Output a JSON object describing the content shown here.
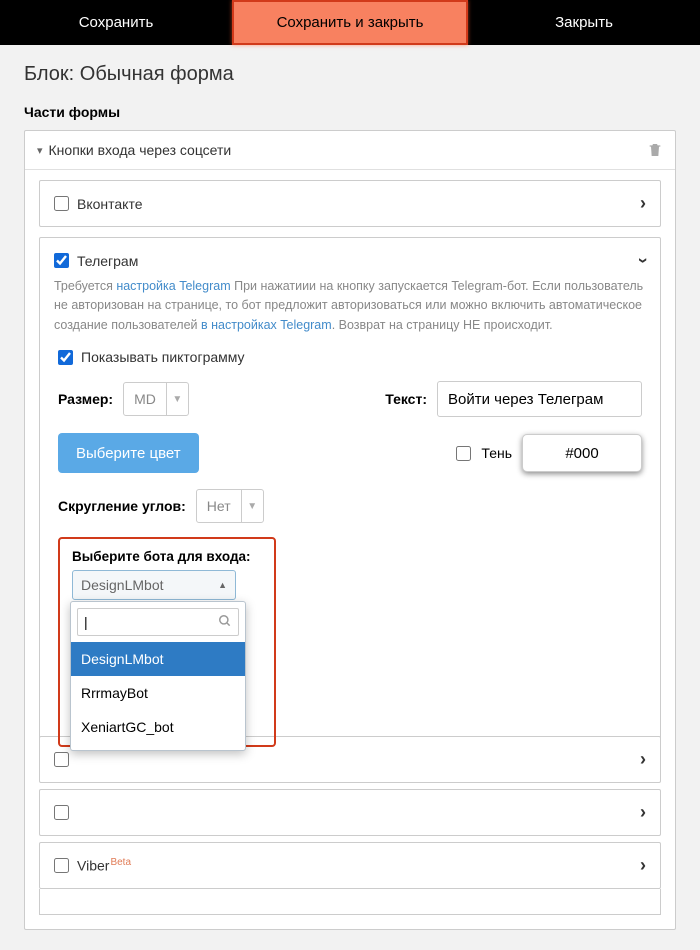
{
  "topbar": {
    "save": "Сохранить",
    "saveClose": "Сохранить и закрыть",
    "close": "Закрыть"
  },
  "page": {
    "title": "Блок: Обычная форма",
    "sectionTitle": "Части формы"
  },
  "social": {
    "headerTitle": "Кнопки входа через соцсети"
  },
  "vk": {
    "label": "Вконтакте"
  },
  "telegram": {
    "label": "Телеграм",
    "descPrefix": "Требуется ",
    "descLink1": "настройка Telegram",
    "descMid": " При нажатиии на кнопку запускается Telegram-бот. Если пользователь не авторизован на странице, то бот предложит авторизоваться или можно включить автоматическое создание пользователей ",
    "descLink2": "в настройках Telegram",
    "descSuffix": ". Возврат на страницу НЕ происходит.",
    "showIcon": "Показывать пиктограмму",
    "sizeLabel": "Размер:",
    "sizeVal": "MD",
    "textLabel": "Текст:",
    "textVal": "Войти через Телеграм",
    "colorBtn": "Выберите цвет",
    "shadowLabel": "Тень",
    "shadowVal": "#000",
    "radiusLabel": "Скругление углов:",
    "radiusVal": "Нет",
    "botLabel": "Выберите бота для входа:",
    "botSelected": "DesignLMbot",
    "botOptions": [
      "DesignLMbot",
      "RrrmayBot",
      "XeniartGC_bot"
    ]
  },
  "viber": {
    "label": "Viber",
    "badge": "Beta"
  }
}
